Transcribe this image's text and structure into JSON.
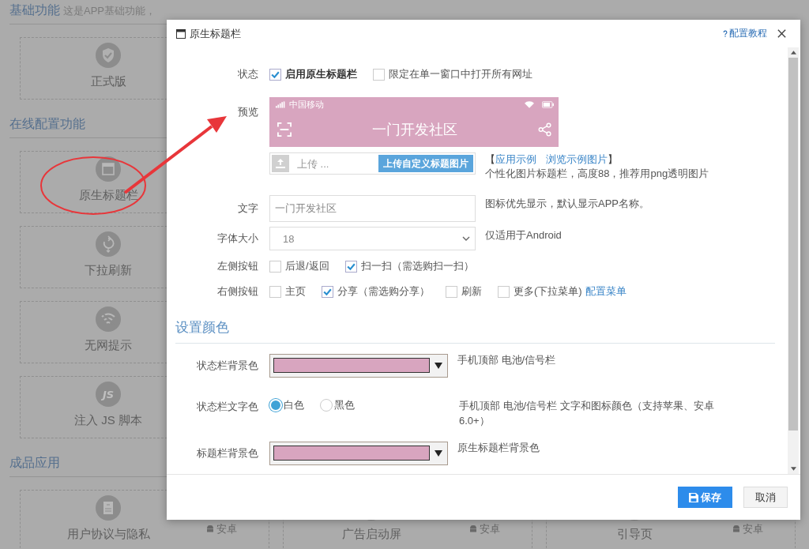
{
  "page": {
    "sections": [
      {
        "title": "基础功能",
        "description": "这是APP基础功能，",
        "cards": [
          {
            "label": "正式版",
            "kind": "shield"
          }
        ]
      },
      {
        "title": "在线配置功能",
        "cards": [
          {
            "label": "原生标题栏",
            "kind": "titlebar"
          },
          {
            "label": "下拉刷新",
            "kind": "refresh"
          },
          {
            "label": "无网提示",
            "kind": "wifi-off"
          },
          {
            "label": "注入 JS 脚本",
            "kind": "text",
            "icon_text": "JS"
          }
        ]
      },
      {
        "title": "成品应用",
        "cards": [
          {
            "label": "用户协议与隐私",
            "kind": "document",
            "badge": "安卓"
          },
          {
            "label": "广告启动屏",
            "kind": "blank",
            "badge": "安卓"
          },
          {
            "label": "引导页",
            "kind": "blank",
            "badge": "安卓"
          }
        ]
      }
    ]
  },
  "dialog": {
    "title": "原生标题栏",
    "help_link": "配置教程",
    "status": {
      "label": "状态",
      "options": [
        {
          "label": "启用原生标题栏",
          "checked": true
        },
        {
          "label": "限定在单一窗口中打开所有网址",
          "checked": false
        }
      ]
    },
    "preview": {
      "label": "预览",
      "carrier": "中国移动",
      "title": "一门开发社区"
    },
    "upload": {
      "placeholder": "上传 ...",
      "button": "上传自定义标题图片",
      "open_bracket": "【",
      "links": [
        "应用示例",
        "浏览示例图片"
      ],
      "close_bracket": "】",
      "hint": "个性化图片标题栏，高度88，推荐用png透明图片"
    },
    "text_field": {
      "label": "文字",
      "value": "一门开发社区",
      "hint": "图标优先显示，默认显示APP名称。"
    },
    "font_size": {
      "label": "字体大小",
      "value": "18",
      "hint": "仅适用于Android"
    },
    "left_buttons": {
      "label": "左侧按钮",
      "options": [
        {
          "label": "后退/返回",
          "checked": false
        },
        {
          "label": "扫一扫（需选购扫一扫）",
          "checked": true
        }
      ]
    },
    "right_buttons": {
      "label": "右侧按钮",
      "options": [
        {
          "label": "主页",
          "checked": false
        },
        {
          "label": "分享（需选购分享）",
          "checked": true
        },
        {
          "label": "刷新",
          "checked": false
        },
        {
          "label": "更多(下拉菜单)",
          "checked": false
        }
      ],
      "link": "配置菜单"
    },
    "color_section": {
      "title": "设置颜色",
      "rows": [
        {
          "kind": "color",
          "label": "状态栏背景色",
          "color": "#d8a5bf",
          "hint": "手机顶部 电池/信号栏"
        },
        {
          "kind": "radio",
          "label": "状态栏文字色",
          "options": [
            {
              "label": "白色",
              "selected": true
            },
            {
              "label": "黑色",
              "selected": false
            }
          ],
          "hint": "手机顶部 电池/信号栏 文字和图标颜色（支持苹果、安卓6.0+）"
        },
        {
          "kind": "color",
          "label": "标题栏背景色",
          "color": "#d8a5bf",
          "hint": "原生标题栏背景色"
        }
      ]
    },
    "buttons": [
      {
        "kind": "primary",
        "label": "保存"
      },
      {
        "kind": "default",
        "label": "取消"
      }
    ]
  }
}
